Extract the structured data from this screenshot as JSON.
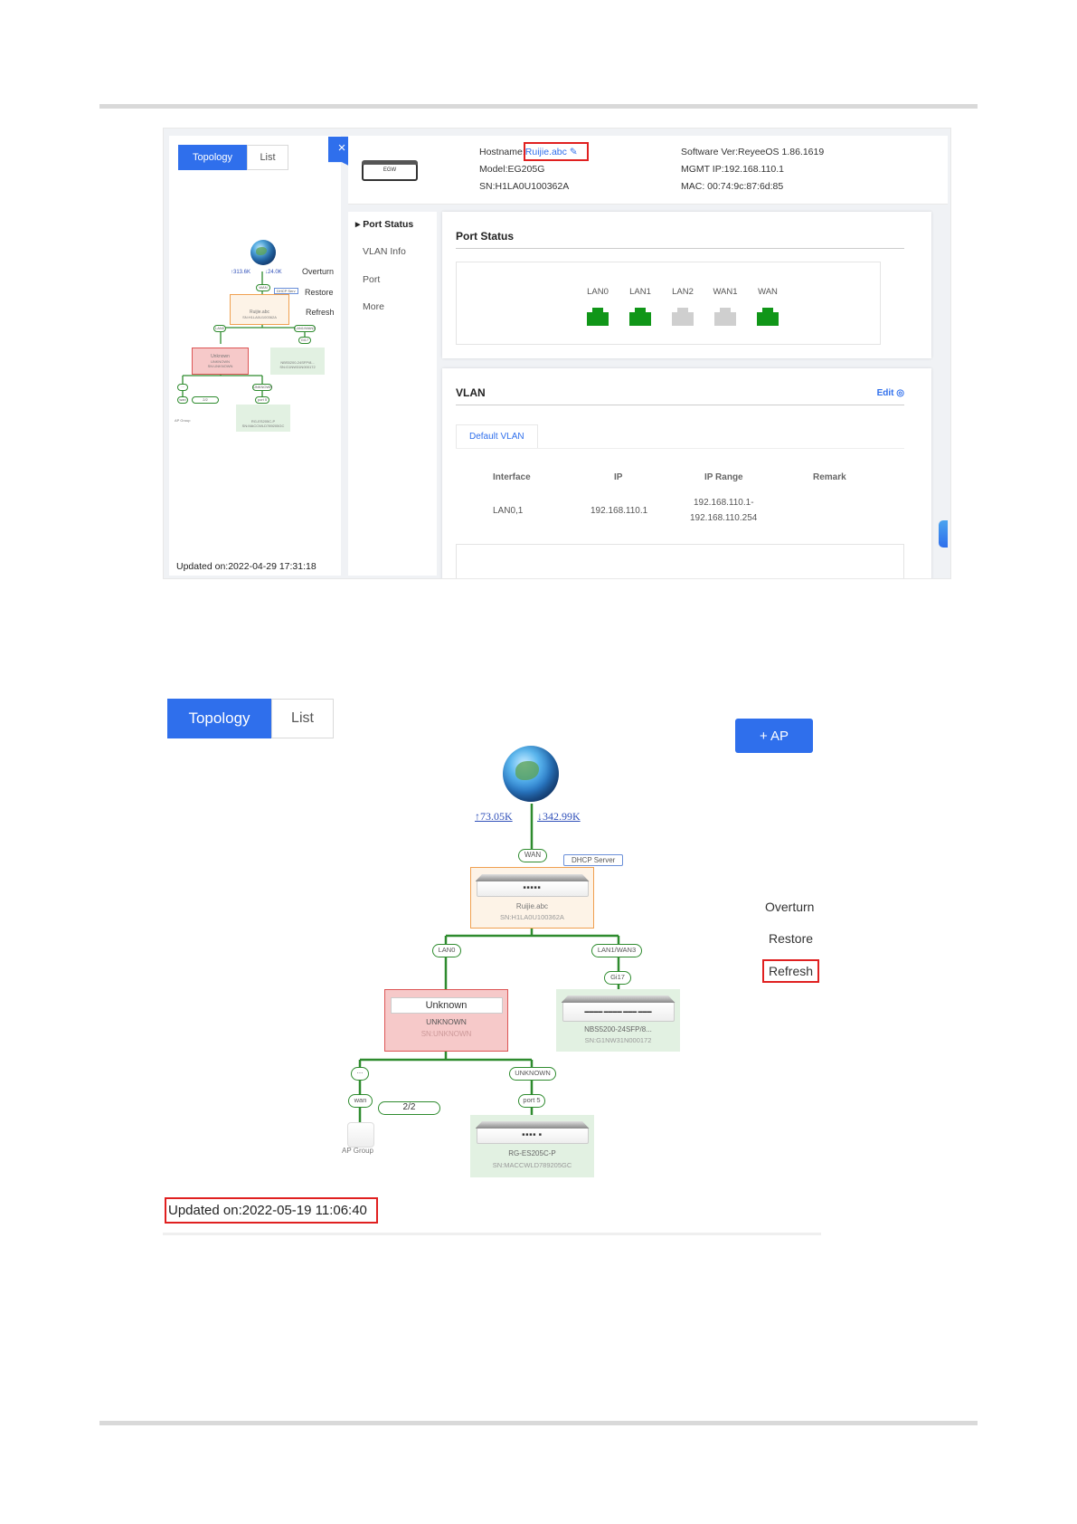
{
  "top_screenshot": {
    "tabs": [
      "Topology",
      "List"
    ],
    "close_glyph": "×",
    "device": {
      "icon_text": "EGW",
      "hostname_label": "Hostname:",
      "hostname": "Ruijie.abc",
      "model": "Model:EG205G",
      "sn": "SN:H1LA0U100362A",
      "software": "Software Ver:ReyeeOS 1.86.1619",
      "mgmt_ip": "MGMT IP:192.168.110.1",
      "mac": "MAC: 00:74:9c:87:6d:85"
    },
    "nav": [
      "Port Status",
      "VLAN Info",
      "Port",
      "More"
    ],
    "port_status": {
      "title": "Port Status",
      "ports": [
        {
          "label": "LAN0",
          "state": "up"
        },
        {
          "label": "LAN1",
          "state": "up"
        },
        {
          "label": "LAN2",
          "state": "down"
        },
        {
          "label": "WAN1",
          "state": "down"
        },
        {
          "label": "WAN",
          "state": "up"
        }
      ]
    },
    "vlan": {
      "title": "VLAN",
      "edit": "Edit",
      "tab": "Default VLAN",
      "columns": [
        "Interface",
        "IP",
        "IP Range",
        "Remark"
      ],
      "row": {
        "interface": "LAN0,1",
        "ip": "192.168.110.1",
        "range1": "192.168.110.1-",
        "range2": "192.168.110.254",
        "remark": ""
      }
    },
    "mini_topology": {
      "upload": "↑313.6K",
      "download": "↓24.0K",
      "actions": [
        "Overturn",
        "Restore",
        "Refresh"
      ],
      "wan": "WAN",
      "dhcp": "DHCP Serv",
      "root_name": "Ruijie.abc",
      "root_sn": "SN:H1LA0U100362A",
      "lan0": "LAN0",
      "lan1": "LAN1/WAN3",
      "gi": "Gi17",
      "unknown_title": "Unknown",
      "unknown_model": "UNKNOWN",
      "unknown_sn": "SN:UNKNOWN",
      "switch_model": "NBS5200-24SFP/8...",
      "switch_sn": "SN:G1NW31N000172",
      "unknown_tag": "UNKNOWN",
      "port5": "port 5",
      "wan_small": "wan",
      "dots": "...",
      "count": "2/2",
      "ap_group": "AP Group",
      "bottom_model": "RG-ES205C-P",
      "bottom_sn": "SN:MACCWLD789205GC"
    },
    "updated": "Updated on:2022-04-29 17:31:18"
  },
  "bottom_screenshot": {
    "tabs": [
      "Topology",
      "List"
    ],
    "add_ap": "+ AP",
    "upload": "↑73.05K",
    "download": "↓342.99K",
    "wan": "WAN",
    "dhcp": "DHCP Server",
    "root_dots": "■■■■■",
    "root_name": "Ruijie.abc",
    "root_sn": "SN:H1LA0U100362A",
    "lan0": "LAN0",
    "lan1": "LAN1/WAN3",
    "gi": "Gi17",
    "unknown_title": "Unknown",
    "unknown_model": "UNKNOWN",
    "unknown_sn": "SN:UNKNOWN",
    "switch_dots": "▬▬▬▬ ▬▬▬▬ ▬▬▬ ▬▬▬",
    "switch_model": "NBS5200-24SFP/8...",
    "switch_sn": "SN:G1NW31N000172",
    "dots": "...",
    "unknown_tag": "UNKNOWN",
    "wan_small": "wan",
    "count": "2/2",
    "port5": "port 5",
    "ap_group": "AP Group",
    "es_dots": "■■■■ ■",
    "bottom_model": "RG-ES205C-P",
    "bottom_sn": "SN:MACCWLD789205GC",
    "actions": [
      "Overturn",
      "Restore",
      "Refresh"
    ],
    "updated": "Updated on:2022-05-19 11:06:40"
  },
  "colors": {
    "accent": "#2f6fec",
    "link_green": "#2e8b2e",
    "port_up": "#109618",
    "highlight": "#e02020"
  }
}
